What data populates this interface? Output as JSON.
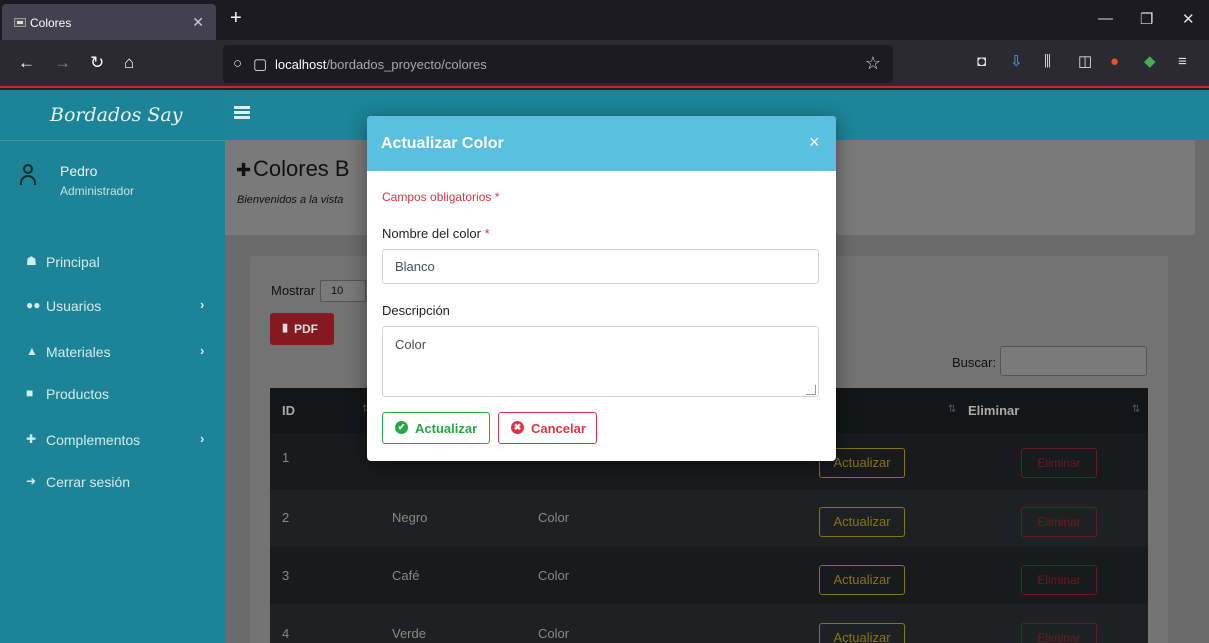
{
  "browser": {
    "tab_title": "Colores",
    "url_host": "localhost",
    "url_path": "/bordados_proyecto/colores"
  },
  "sidebar": {
    "brand": "Bordados Say",
    "user_name": "Pedro",
    "user_role": "Administrador",
    "items": [
      {
        "label": "Principal",
        "icon": "home-icon",
        "has_submenu": false
      },
      {
        "label": "Usuarios",
        "icon": "users-icon",
        "has_submenu": true
      },
      {
        "label": "Materiales",
        "icon": "materials-icon",
        "has_submenu": true
      },
      {
        "label": "Productos",
        "icon": "bag-icon",
        "has_submenu": false
      },
      {
        "label": "Complementos",
        "icon": "puzzle-icon",
        "has_submenu": true
      },
      {
        "label": "Cerrar sesión",
        "icon": "logout-icon",
        "has_submenu": false
      }
    ]
  },
  "main": {
    "title_visible": "Colores B",
    "subtitle_visible": "Bienvenidos a la vista",
    "mostrar_label": "Mostrar",
    "mostrar_value": "10",
    "pdf_label": "PDF",
    "buscar_label": "Buscar:",
    "table": {
      "headers": {
        "id": "ID",
        "eliminar": "Eliminar"
      },
      "rows": [
        {
          "id": "1",
          "nombre": "",
          "descripcion": "",
          "act": "Actualizar",
          "del": "Eliminar"
        },
        {
          "id": "2",
          "nombre": "Negro",
          "descripcion": "Color",
          "act": "Actualizar",
          "del": "Eliminar"
        },
        {
          "id": "3",
          "nombre": "Café",
          "descripcion": "Color",
          "act": "Actualizar",
          "del": "Eliminar"
        },
        {
          "id": "4",
          "nombre": "Verde",
          "descripcion": "Color",
          "act": "Actualizar",
          "del": "Eliminar"
        }
      ]
    }
  },
  "modal": {
    "title": "Actualizar Color",
    "close_symbol": "×",
    "required_note": "Campos obligatorios",
    "required_mark": "*",
    "name_label": "Nombre del color",
    "name_value": "Blanco",
    "desc_label": "Descripción",
    "desc_value": "Color",
    "update_label": "Actualizar",
    "cancel_label": "Cancelar"
  },
  "colors": {
    "accent": "#5bc0de",
    "sidebar": "#1d8497",
    "success": "#28a745",
    "danger": "#dc3545",
    "warning": "#ffc107"
  }
}
